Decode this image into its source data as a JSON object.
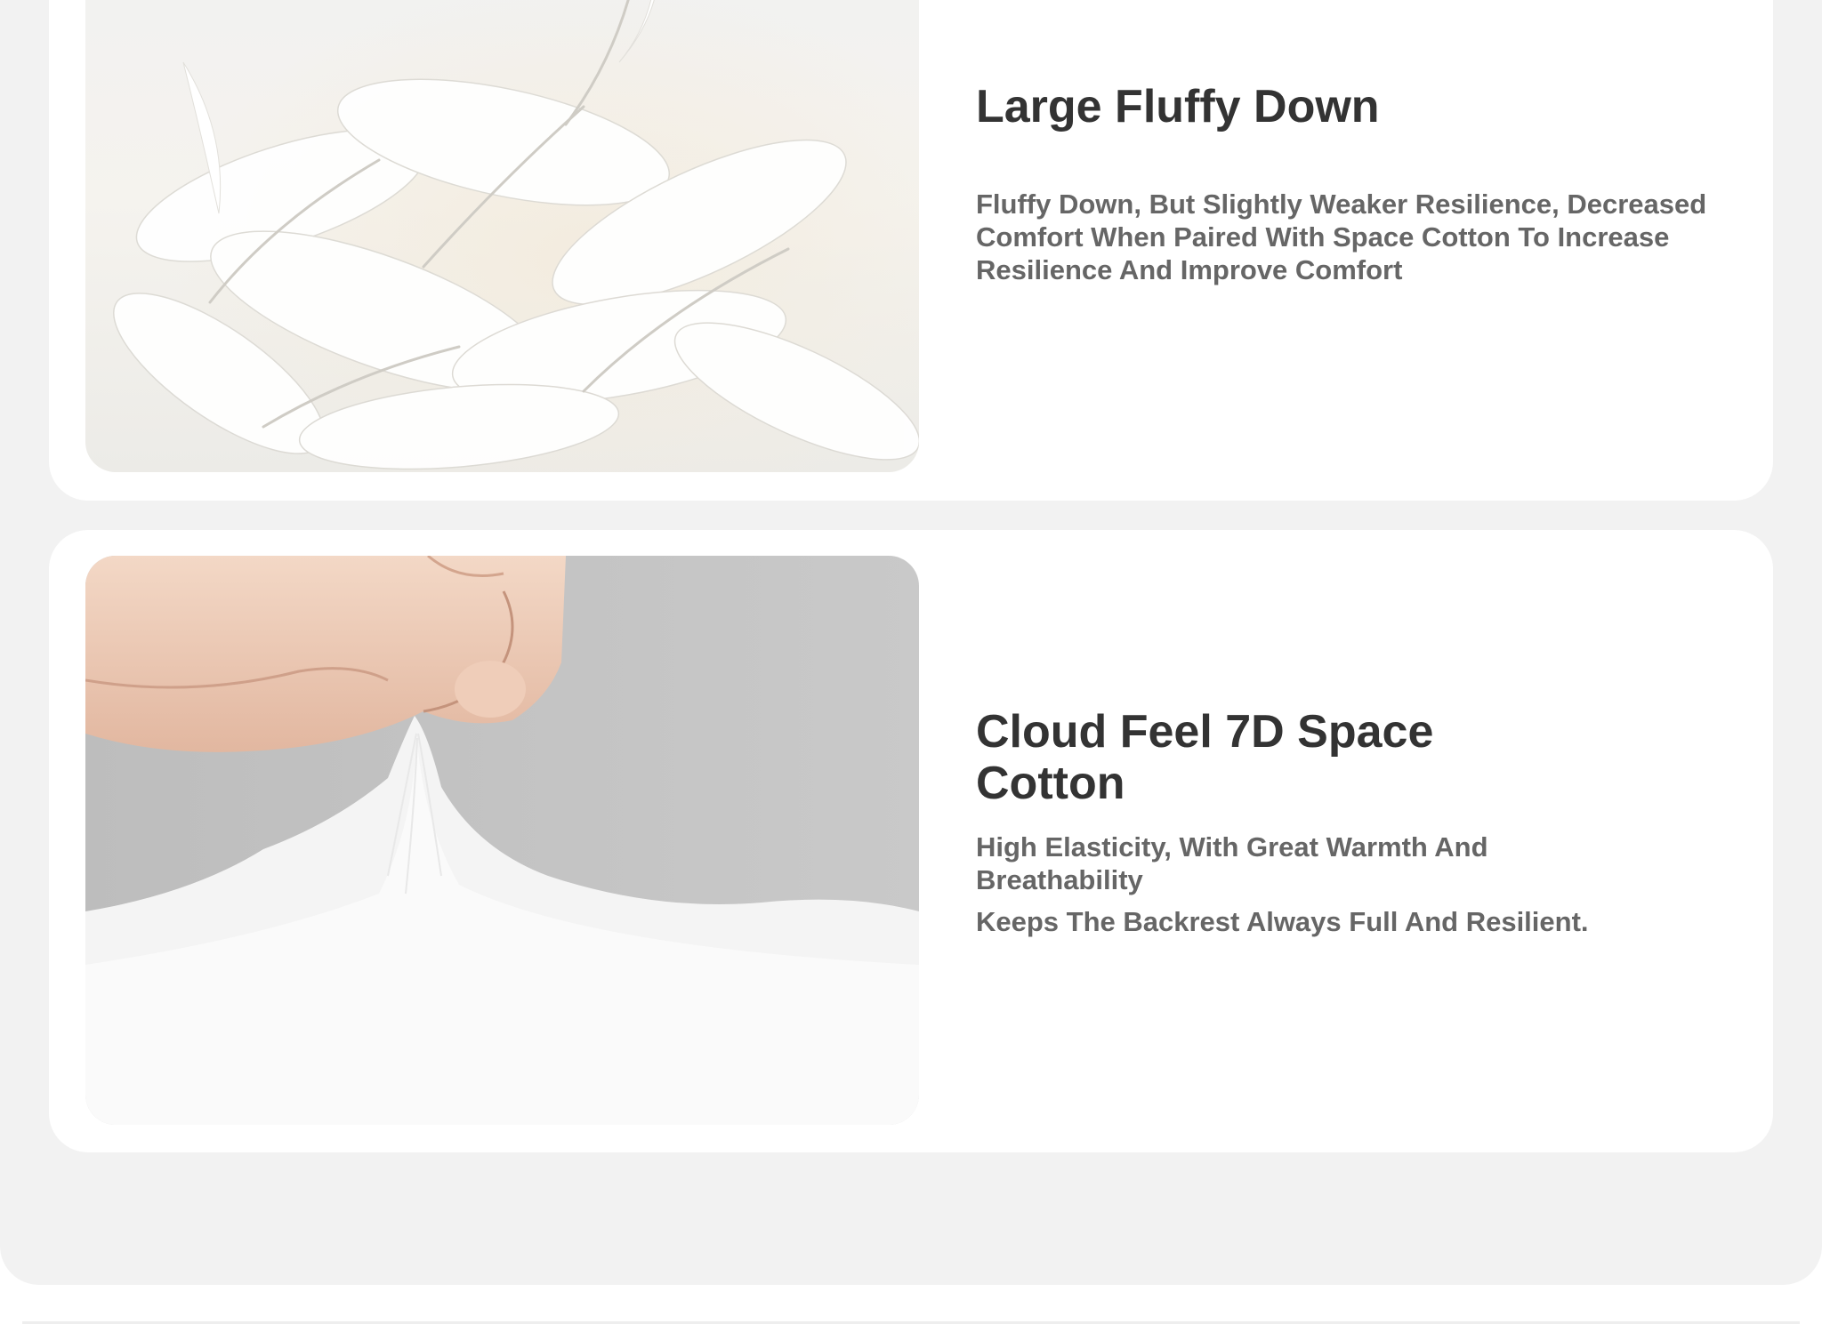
{
  "features": [
    {
      "heading": "Large Fluffy Down",
      "description": "Fluffy Down, But Slightly Weaker Resilience, Decreased Comfort When Paired With Space Cotton To Increase Resilience And Improve Comfort",
      "image": "white-feathers-photo"
    },
    {
      "heading": "Cloud Feel 7D Space Cotton",
      "description": "High Elasticity, With Great Warmth And Breathability",
      "description_2": "Keeps The Backrest Always Full And Resilient.",
      "image": "hand-pulling-cotton-photo"
    }
  ]
}
